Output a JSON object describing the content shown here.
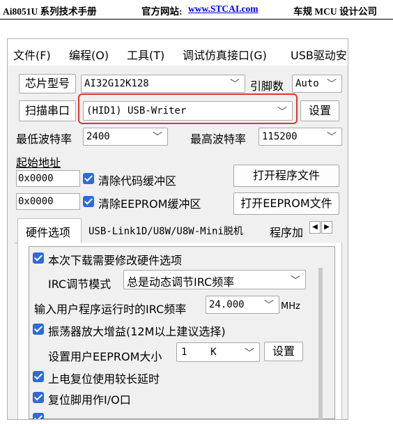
{
  "doc_header": {
    "left": "Ai8051U 系列技术手册",
    "site_label": "官方网站:",
    "site_link": "www.STCAI.com",
    "right": "车规 MCU 设计公司"
  },
  "menu": [
    "文件(F)",
    "编程(O)",
    "工具(T)",
    "调试仿真接口(G)",
    "USB驱动安"
  ],
  "chip": {
    "label": "芯片型号",
    "value": "AI32G12K128"
  },
  "pins": {
    "label": "引脚数",
    "value": "Auto"
  },
  "port": {
    "button": "扫描串口",
    "value": "(HID1) USB-Writer",
    "settings": "设置"
  },
  "baud": {
    "min_label": "最低波特率",
    "min_value": "2400",
    "max_label": "最高波特率",
    "max_value": "115200"
  },
  "start_addr": {
    "label": "起始地址"
  },
  "code_row": {
    "addr": "0x0000",
    "check": "清除代码缓冲区",
    "button": "打开程序文件"
  },
  "eeprom_row": {
    "addr": "0x0000",
    "check": "清除EEPROM缓冲区",
    "button": "打开EEPROM文件"
  },
  "tabs": [
    "硬件选项",
    "USB-Link1D/U8W/U8W-Mini脱机",
    "程序加"
  ],
  "options": {
    "modify_hw": "本次下载需要修改硬件选项",
    "irc_mode_label": "IRC调节模式",
    "irc_mode_value": "总是动态调节IRC频率",
    "irc_freq_label": "输入用户程序运行时的IRC频率",
    "irc_freq_value": "24.000",
    "irc_freq_unit": "MHz",
    "osc_gain": "振荡器放大增益(12M以上建议选择)",
    "eeprom_size_label": "设置用户EEPROM大小",
    "eeprom_size_value": "1    K",
    "eeprom_set": "设置",
    "long_reset": "上电复位使用较长延时",
    "reset_io": "复位脚用作I/O口"
  }
}
